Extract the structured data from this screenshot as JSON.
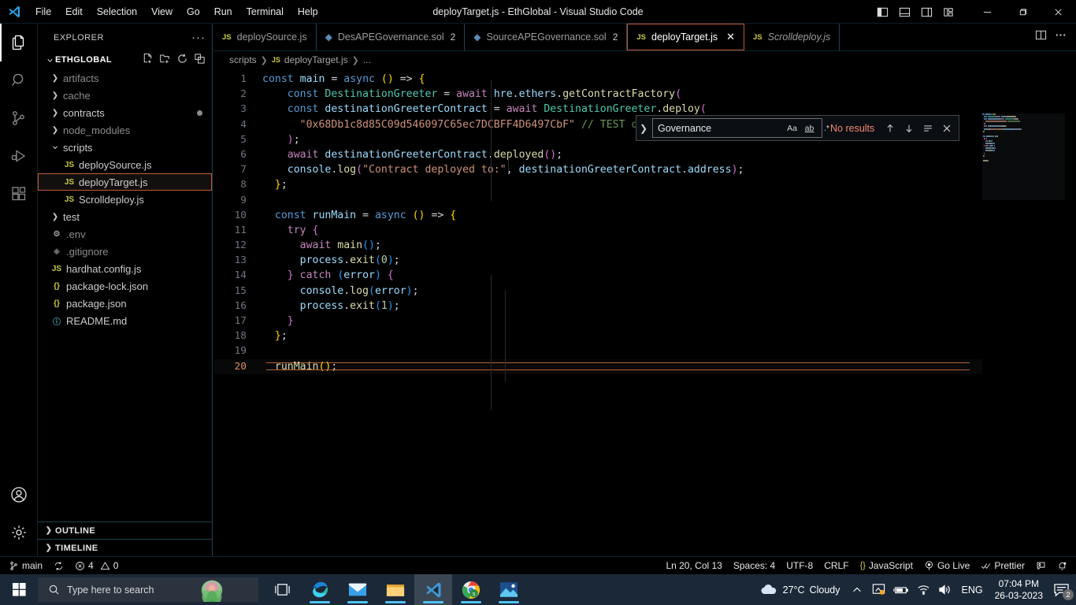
{
  "window": {
    "title": "deployTarget.js - EthGlobal - Visual Studio Code",
    "logo_icon": "vscode-logo-icon",
    "minimize_label": "—",
    "maximize_label": "❐",
    "close_label": "✕"
  },
  "menubar": {
    "items": [
      {
        "label": "File"
      },
      {
        "label": "Edit"
      },
      {
        "label": "Selection"
      },
      {
        "label": "View"
      },
      {
        "label": "Go"
      },
      {
        "label": "Run"
      },
      {
        "label": "Terminal"
      },
      {
        "label": "Help"
      }
    ]
  },
  "layout_controls": [
    {
      "name": "toggle-primary-sidebar-icon"
    },
    {
      "name": "toggle-panel-icon"
    },
    {
      "name": "toggle-secondary-sidebar-icon"
    },
    {
      "name": "customize-layout-icon"
    }
  ],
  "activity_bar": {
    "items": [
      {
        "name": "explorer-icon",
        "label": "Explorer",
        "active": true
      },
      {
        "name": "search-icon",
        "label": "Search",
        "active": false
      },
      {
        "name": "source-control-icon",
        "label": "Source Control",
        "active": false
      },
      {
        "name": "run-and-debug-icon",
        "label": "Run and Debug",
        "active": false
      },
      {
        "name": "extensions-icon",
        "label": "Extensions",
        "active": false
      }
    ],
    "bottom_items": [
      {
        "name": "accounts-icon",
        "label": "Accounts"
      },
      {
        "name": "manage-settings-icon",
        "label": "Manage"
      }
    ]
  },
  "sidebar": {
    "title": "EXPLORER",
    "more_actions": "···",
    "root_folder": "ETHGLOBAL",
    "folder_actions": [
      "new-file-icon",
      "new-folder-icon",
      "refresh-explorer-icon",
      "collapse-folders-icon"
    ],
    "tree": [
      {
        "label": "artifacts",
        "type": "folder",
        "expanded": false,
        "indent": 1,
        "dim": true
      },
      {
        "label": "cache",
        "type": "folder",
        "expanded": false,
        "indent": 1,
        "dim": true
      },
      {
        "label": "contracts",
        "type": "folder",
        "expanded": false,
        "indent": 1,
        "dim": false,
        "modified": true
      },
      {
        "label": "node_modules",
        "type": "folder",
        "expanded": false,
        "indent": 1,
        "dim": true
      },
      {
        "label": "scripts",
        "type": "folder",
        "expanded": true,
        "indent": 1,
        "dim": false
      },
      {
        "label": "deploySource.js",
        "type": "js",
        "indent": 2,
        "selected": false
      },
      {
        "label": "deployTarget.js",
        "type": "js",
        "indent": 2,
        "selected": true
      },
      {
        "label": "Scrolldeploy.js",
        "type": "js",
        "indent": 2,
        "selected": false
      },
      {
        "label": "test",
        "type": "folder",
        "expanded": false,
        "indent": 1,
        "dim": false
      },
      {
        "label": ".env",
        "type": "env",
        "indent": 1,
        "dim": true
      },
      {
        "label": ".gitignore",
        "type": "gitignore",
        "indent": 1,
        "dim": true
      },
      {
        "label": "hardhat.config.js",
        "type": "js",
        "indent": 1
      },
      {
        "label": "package-lock.json",
        "type": "json",
        "indent": 1
      },
      {
        "label": "package.json",
        "type": "json",
        "indent": 1
      },
      {
        "label": "README.md",
        "type": "md",
        "indent": 1
      }
    ],
    "sections": [
      {
        "label": "OUTLINE",
        "expanded": false
      },
      {
        "label": "TIMELINE",
        "expanded": false
      }
    ]
  },
  "tabs": [
    {
      "label": "deploySource.js",
      "icon": "js",
      "active": false,
      "dirty_count": "",
      "italic": false,
      "closable": false
    },
    {
      "label": "DesAPEGovernance.sol",
      "icon": "sol",
      "active": false,
      "dirty_count": "2",
      "italic": false,
      "closable": false
    },
    {
      "label": "SourceAPEGovernance.sol",
      "icon": "sol",
      "active": false,
      "dirty_count": "2",
      "italic": false,
      "closable": false
    },
    {
      "label": "deployTarget.js",
      "icon": "js",
      "active": true,
      "dirty_count": "",
      "italic": false,
      "closable": true
    },
    {
      "label": "Scrolldeploy.js",
      "icon": "js",
      "active": false,
      "dirty_count": "",
      "italic": true,
      "closable": false
    }
  ],
  "tab_actions": [
    {
      "name": "split-editor-icon"
    },
    {
      "name": "editor-more-actions-icon"
    }
  ],
  "breadcrumb": {
    "items": [
      {
        "label": "scripts",
        "icon": ""
      },
      {
        "label": "deployTarget.js",
        "icon": "js"
      },
      {
        "label": "...",
        "icon": ""
      }
    ]
  },
  "find_widget": {
    "expand_icon": "chevron-right-icon",
    "query": "Governance",
    "placeholder": "Find",
    "match_case_label": "Aa",
    "whole_word_label": "ab",
    "regex_label": ".*",
    "status": "No results",
    "previous_icon": "arrow-up-icon",
    "next_icon": "arrow-down-icon",
    "find_in_selection_icon": "selection-find-icon",
    "close_icon": "close-icon"
  },
  "editor": {
    "language_mode": "JavaScript",
    "lines": [
      {
        "n": 1,
        "tokens": [
          [
            "kw",
            "const"
          ],
          [
            "pun",
            " "
          ],
          [
            "var",
            "main"
          ],
          [
            "pun",
            " = "
          ],
          [
            "kw",
            "async"
          ],
          [
            "pun",
            " "
          ],
          [
            "par1",
            "()"
          ],
          [
            "pun",
            " => "
          ],
          [
            "par1",
            "{"
          ]
        ]
      },
      {
        "n": 2,
        "tokens": [
          [
            "pun",
            "    "
          ],
          [
            "kw",
            "const"
          ],
          [
            "pun",
            " "
          ],
          [
            "cls",
            "DestinationGreeter"
          ],
          [
            "pun",
            " = "
          ],
          [
            "kw2",
            "await"
          ],
          [
            "pun",
            " "
          ],
          [
            "var",
            "hre"
          ],
          [
            "pun",
            "."
          ],
          [
            "var",
            "ethers"
          ],
          [
            "pun",
            "."
          ],
          [
            "fn",
            "getContractFactory"
          ],
          [
            "par2",
            "("
          ]
        ]
      },
      {
        "n": 3,
        "tokens": [
          [
            "pun",
            "    "
          ],
          [
            "kw",
            "const"
          ],
          [
            "pun",
            " "
          ],
          [
            "var",
            "destinationGreeterContract"
          ],
          [
            "pun",
            " = "
          ],
          [
            "kw2",
            "await"
          ],
          [
            "pun",
            " "
          ],
          [
            "cls",
            "DestinationGreeter"
          ],
          [
            "pun",
            "."
          ],
          [
            "fn",
            "deploy"
          ],
          [
            "par2",
            "("
          ]
        ]
      },
      {
        "n": 4,
        "tokens": [
          [
            "pun",
            "      "
          ],
          [
            "str",
            "\"0x68Db1c8d85C09d546097C65ec7DCBFF4D6497CbF\""
          ],
          [
            "pun",
            " "
          ],
          [
            "cmt",
            "// TEST on Optimism-Goerli"
          ]
        ]
      },
      {
        "n": 5,
        "tokens": [
          [
            "pun",
            "    "
          ],
          [
            "par2",
            ")"
          ],
          [
            "pun",
            ";"
          ]
        ]
      },
      {
        "n": 6,
        "tokens": [
          [
            "pun",
            "    "
          ],
          [
            "kw2",
            "await"
          ],
          [
            "pun",
            " "
          ],
          [
            "var",
            "destinationGreeterContract"
          ],
          [
            "pun",
            "."
          ],
          [
            "fn",
            "deployed"
          ],
          [
            "par2",
            "()"
          ],
          [
            "pun",
            ";"
          ]
        ]
      },
      {
        "n": 7,
        "tokens": [
          [
            "pun",
            "    "
          ],
          [
            "var",
            "console"
          ],
          [
            "pun",
            "."
          ],
          [
            "fn",
            "log"
          ],
          [
            "par2",
            "("
          ],
          [
            "str",
            "\"Contract deployed to:\""
          ],
          [
            "pun",
            ", "
          ],
          [
            "var",
            "destinationGreeterContract"
          ],
          [
            "pun",
            "."
          ],
          [
            "var",
            "address"
          ],
          [
            "par2",
            ")"
          ],
          [
            "pun",
            ";"
          ]
        ]
      },
      {
        "n": 8,
        "tokens": [
          [
            "pun",
            "  "
          ],
          [
            "par1",
            "}"
          ],
          [
            "pun",
            ";"
          ]
        ]
      },
      {
        "n": 9,
        "tokens": []
      },
      {
        "n": 10,
        "tokens": [
          [
            "pun",
            "  "
          ],
          [
            "kw",
            "const"
          ],
          [
            "pun",
            " "
          ],
          [
            "var",
            "runMain"
          ],
          [
            "pun",
            " = "
          ],
          [
            "kw",
            "async"
          ],
          [
            "pun",
            " "
          ],
          [
            "par1",
            "()"
          ],
          [
            "pun",
            " => "
          ],
          [
            "par1",
            "{"
          ]
        ]
      },
      {
        "n": 11,
        "tokens": [
          [
            "pun",
            "    "
          ],
          [
            "kw2",
            "try"
          ],
          [
            "pun",
            " "
          ],
          [
            "par2",
            "{"
          ]
        ]
      },
      {
        "n": 12,
        "tokens": [
          [
            "pun",
            "      "
          ],
          [
            "kw2",
            "await"
          ],
          [
            "pun",
            " "
          ],
          [
            "fn",
            "main"
          ],
          [
            "par3",
            "()"
          ],
          [
            "pun",
            ";"
          ]
        ]
      },
      {
        "n": 13,
        "tokens": [
          [
            "pun",
            "      "
          ],
          [
            "var",
            "process"
          ],
          [
            "pun",
            "."
          ],
          [
            "fn",
            "exit"
          ],
          [
            "par3",
            "("
          ],
          [
            "num",
            "0"
          ],
          [
            "par3",
            ")"
          ],
          [
            "pun",
            ";"
          ]
        ]
      },
      {
        "n": 14,
        "tokens": [
          [
            "pun",
            "    "
          ],
          [
            "par2",
            "}"
          ],
          [
            "pun",
            " "
          ],
          [
            "kw2",
            "catch"
          ],
          [
            "pun",
            " "
          ],
          [
            "par3",
            "("
          ],
          [
            "var",
            "error"
          ],
          [
            "par3",
            ")"
          ],
          [
            "pun",
            " "
          ],
          [
            "par2",
            "{"
          ]
        ]
      },
      {
        "n": 15,
        "tokens": [
          [
            "pun",
            "      "
          ],
          [
            "var",
            "console"
          ],
          [
            "pun",
            "."
          ],
          [
            "fn",
            "log"
          ],
          [
            "par3",
            "("
          ],
          [
            "var",
            "error"
          ],
          [
            "par3",
            ")"
          ],
          [
            "pun",
            ";"
          ]
        ]
      },
      {
        "n": 16,
        "tokens": [
          [
            "pun",
            "      "
          ],
          [
            "var",
            "process"
          ],
          [
            "pun",
            "."
          ],
          [
            "fn",
            "exit"
          ],
          [
            "par3",
            "("
          ],
          [
            "num",
            "1"
          ],
          [
            "par3",
            ")"
          ],
          [
            "pun",
            ";"
          ]
        ]
      },
      {
        "n": 17,
        "tokens": [
          [
            "pun",
            "    "
          ],
          [
            "par2",
            "}"
          ]
        ]
      },
      {
        "n": 18,
        "tokens": [
          [
            "pun",
            "  "
          ],
          [
            "par1",
            "}"
          ],
          [
            "pun",
            ";"
          ]
        ]
      },
      {
        "n": 19,
        "tokens": []
      },
      {
        "n": 20,
        "tokens": [
          [
            "pun",
            "  "
          ],
          [
            "fn",
            "runMain"
          ],
          [
            "par1",
            "()"
          ],
          [
            "pun",
            ";"
          ]
        ],
        "current": true
      }
    ]
  },
  "status_bar": {
    "left": [
      {
        "name": "remote-branch",
        "icon": "source-control-branch-icon",
        "label": "main"
      },
      {
        "name": "sync-changes",
        "icon": "sync-icon",
        "label": ""
      },
      {
        "name": "problems",
        "icon": "error-warning-icon",
        "label": "4",
        "label2": "0"
      }
    ],
    "right": [
      {
        "name": "editor-position",
        "label": "Ln 20, Col 13"
      },
      {
        "name": "editor-indentation",
        "label": "Spaces: 4"
      },
      {
        "name": "editor-encoding",
        "label": "UTF-8"
      },
      {
        "name": "editor-eol",
        "label": "CRLF"
      },
      {
        "name": "editor-language",
        "label": "JavaScript",
        "icon": "json-braces-icon"
      },
      {
        "name": "go-live",
        "label": "Go Live",
        "icon": "broadcast-icon"
      },
      {
        "name": "prettier",
        "label": "Prettier",
        "icon": "checks-icon"
      },
      {
        "name": "feedback",
        "label": "",
        "icon": "feedback-icon"
      },
      {
        "name": "notifications",
        "label": "",
        "icon": "bell-dot-icon"
      }
    ]
  },
  "taskbar": {
    "start_icon": "windows-start-icon",
    "search_placeholder": "Type here to search",
    "search_icon": "search-icon",
    "cortana_icon": "cortana-icon",
    "pinned": [
      {
        "name": "task-view-icon",
        "running": false
      },
      {
        "name": "microsoft-edge-icon",
        "running": true
      },
      {
        "name": "mail-icon",
        "running": true
      },
      {
        "name": "file-explorer-icon",
        "running": true
      },
      {
        "name": "visual-studio-code-icon",
        "running": true,
        "active": true
      },
      {
        "name": "google-chrome-icon",
        "running": true
      },
      {
        "name": "photos-icon",
        "running": true
      }
    ],
    "tray": {
      "weather_icon": "cloud-icon",
      "weather_temp": "27°C",
      "weather_desc": "Cloudy",
      "show_hidden_icon": "chevron-up-icon",
      "icons": [
        "onedrive-sync-icon",
        "battery-icon",
        "wifi-icon",
        "volume-icon"
      ],
      "language": "ENG",
      "time": "07:04 PM",
      "date": "26-03-2023",
      "notification_icon": "action-center-icon",
      "notification_count": "2"
    }
  },
  "colors": {
    "accent_orange": "#c05a33",
    "editor_bg": "#000000",
    "taskbar_bg": "#1b2838",
    "error_red": "#f48771",
    "js_yellow": "#cbcb41"
  }
}
